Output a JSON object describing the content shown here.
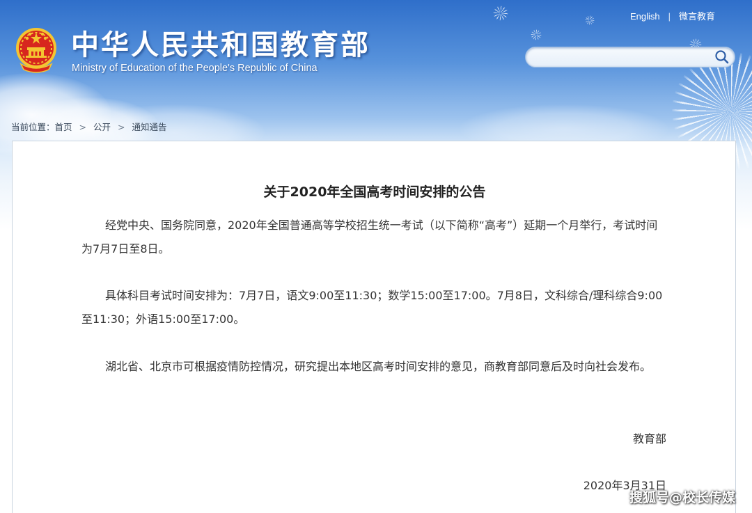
{
  "header": {
    "title": "中华人民共和国教育部",
    "subtitle": "Ministry of Education of the People's Republic of China",
    "links": [
      "English",
      "微言教育"
    ],
    "search": {
      "placeholder": ""
    }
  },
  "breadcrumb": {
    "label": "当前位置：",
    "items": [
      "首页",
      "公开",
      "通知通告"
    ]
  },
  "article": {
    "title": "关于2020年全国高考时间安排的公告",
    "paragraphs": [
      "经党中央、国务院同意，2020年全国普通高等学校招生统一考试（以下简称“高考”）延期一个月举行，考试时间为7月7日至8日。",
      "具体科目考试时间安排为：7月7日，语文9:00至11:30；数学15:00至17:00。7月8日，文科综合/理科综合9:00至11:30；外语15:00至17:00。",
      "湖北省、北京市可根据疫情防控情况，研究提出本地区高考时间安排的意见，商教育部同意后及时向社会发布。"
    ],
    "signature": "教育部",
    "date": "2020年3月31日"
  },
  "watermark": "搜狐号@校长传媒",
  "colors": {
    "header_blue": "#2f6fca",
    "emblem_red": "#d7261e",
    "emblem_gold": "#f4c531",
    "text": "#333333"
  }
}
